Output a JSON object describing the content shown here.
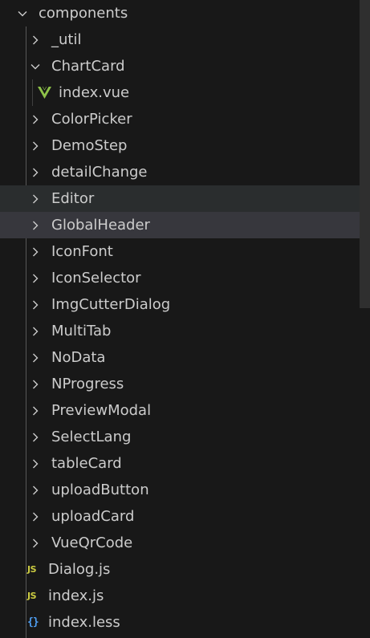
{
  "tree": {
    "root": {
      "label": "components",
      "expanded": true
    },
    "folders_a": [
      {
        "label": "_util",
        "expanded": false
      }
    ],
    "chartcard": {
      "label": "ChartCard",
      "expanded": true,
      "children": [
        {
          "label": "index.vue",
          "icon": "vue-icon"
        }
      ]
    },
    "folders_b": [
      {
        "label": "ColorPicker"
      },
      {
        "label": "DemoStep"
      },
      {
        "label": "detailChange"
      },
      {
        "label": "Editor"
      },
      {
        "label": "GlobalHeader"
      },
      {
        "label": "IconFont"
      },
      {
        "label": "IconSelector"
      },
      {
        "label": "ImgCutterDialog"
      },
      {
        "label": "MultiTab"
      },
      {
        "label": "NoData"
      },
      {
        "label": "NProgress"
      },
      {
        "label": "PreviewModal"
      },
      {
        "label": "SelectLang"
      },
      {
        "label": "tableCard"
      },
      {
        "label": "uploadButton"
      },
      {
        "label": "uploadCard"
      },
      {
        "label": "VueQrCode"
      }
    ],
    "files": [
      {
        "label": "Dialog.js",
        "icon_text": "JS"
      },
      {
        "label": "index.js",
        "icon_text": "JS"
      },
      {
        "label": "index.less",
        "icon_text": "{}"
      }
    ]
  },
  "colors": {
    "background": "#181818",
    "hover_row": "#2a2d2e",
    "selected_row": "#37373d",
    "text": "#cccccc",
    "js_icon": "#cbcb41",
    "less_icon": "#4f9ff3",
    "vue_icon": "#8dc149"
  }
}
